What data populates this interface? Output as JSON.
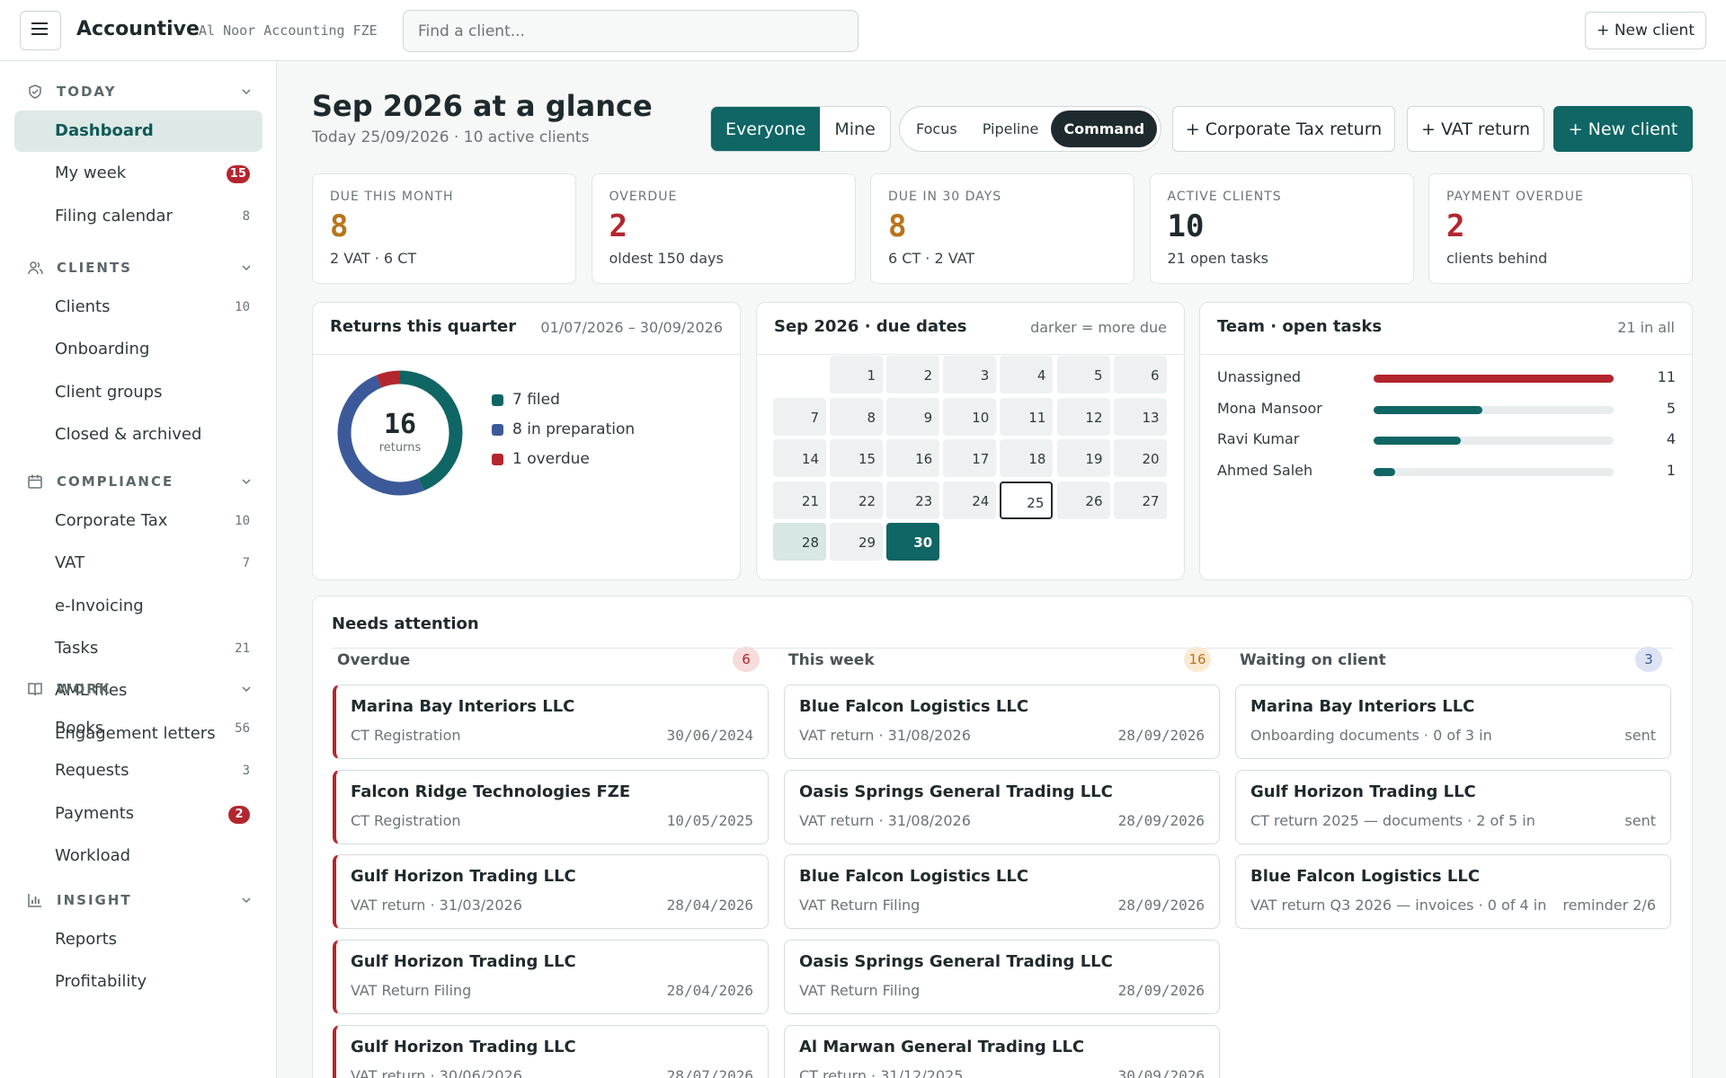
{
  "app": {
    "name": "Accountive",
    "org": "Al Noor Accounting FZE"
  },
  "search": {
    "placeholder": "Find a client..."
  },
  "top_new_label": "+ New client",
  "sidebar": {
    "sections": [
      {
        "label": "TODAY",
        "icon": "shield-check-icon"
      },
      {
        "label": "CLIENTS",
        "icon": "users-icon"
      },
      {
        "label": "COMPLIANCE",
        "icon": "calendar-icon"
      },
      {
        "label": "WORK",
        "icon": "book-icon"
      },
      {
        "label": "INSIGHT",
        "icon": "bar-chart-icon"
      }
    ],
    "items": [
      {
        "label": "Dashboard",
        "count": "",
        "badge": ""
      },
      {
        "label": "My week",
        "count": "",
        "badge": "15"
      },
      {
        "label": "Filing calendar",
        "count": "8",
        "badge": ""
      },
      {
        "label": "Clients",
        "count": "10",
        "badge": ""
      },
      {
        "label": "Onboarding",
        "count": "",
        "badge": ""
      },
      {
        "label": "Client groups",
        "count": "",
        "badge": ""
      },
      {
        "label": "Closed & archived",
        "count": "",
        "badge": ""
      },
      {
        "label": "Corporate Tax",
        "count": "10",
        "badge": ""
      },
      {
        "label": "VAT",
        "count": "7",
        "badge": ""
      },
      {
        "label": "e-Invoicing",
        "count": "",
        "badge": ""
      },
      {
        "label": "Tasks",
        "count": "21",
        "badge": ""
      },
      {
        "label": "AML files",
        "count": "",
        "badge": ""
      },
      {
        "label": "Engagement letters",
        "count": "",
        "badge": ""
      },
      {
        "label": "Books",
        "count": "56",
        "badge": ""
      },
      {
        "label": "Requests",
        "count": "3",
        "badge": ""
      },
      {
        "label": "Payments",
        "count": "",
        "badge": "2"
      },
      {
        "label": "Workload",
        "count": "",
        "badge": ""
      },
      {
        "label": "Reports",
        "count": "",
        "badge": ""
      },
      {
        "label": "Profitability",
        "count": "",
        "badge": ""
      }
    ]
  },
  "header": {
    "title": "Sep 2026 at a glance",
    "subtitle": "Today 25/09/2026 · 10 active clients"
  },
  "scope": {
    "options": [
      "Everyone",
      "Mine"
    ],
    "selected": "Everyone"
  },
  "view": {
    "options": [
      "Focus",
      "Pipeline",
      "Command"
    ],
    "selected": "Command"
  },
  "actions": {
    "ct_return": "+ Corporate Tax return",
    "vat_return": "+ VAT return",
    "new_client": "+ New client"
  },
  "kpis": [
    {
      "label": "DUE THIS MONTH",
      "value": "8",
      "sub": "2 VAT · 6 CT",
      "color": "#b8741a"
    },
    {
      "label": "OVERDUE",
      "value": "2",
      "sub": "oldest 150 days",
      "color": "#b3262d"
    },
    {
      "label": "DUE IN 30 DAYS",
      "value": "8",
      "sub": "6 CT · 2 VAT",
      "color": "#b8741a"
    },
    {
      "label": "ACTIVE CLIENTS",
      "value": "10",
      "sub": "21 open tasks",
      "color": "#1f2a2e"
    },
    {
      "label": "PAYMENT OVERDUE",
      "value": "2",
      "sub": "clients behind",
      "color": "#b3262d"
    }
  ],
  "returns": {
    "title": "Returns this quarter",
    "range": "01/07/2026 – 30/09/2026",
    "total": "16",
    "total_label": "returns",
    "segments": [
      {
        "label": "7 filed",
        "value": 7,
        "color": "#0f6664"
      },
      {
        "label": "8 in preparation",
        "value": 8,
        "color": "#3c5a9a"
      },
      {
        "label": "1 overdue",
        "value": 1,
        "color": "#b3262d"
      }
    ]
  },
  "calendar": {
    "title": "Sep 2026 · due dates",
    "note": "darker = more due",
    "first_weekday": 1,
    "days_in_month": 30,
    "today": 25,
    "highlight": 30,
    "light": 28
  },
  "team": {
    "title": "Team · open tasks",
    "total": "21 in all",
    "members": [
      {
        "name": "Unassigned",
        "count": 11,
        "color": "#b3262d"
      },
      {
        "name": "Mona Mansoor",
        "count": 5,
        "color": "#0f6664"
      },
      {
        "name": "Ravi Kumar",
        "count": 4,
        "color": "#0f6664"
      },
      {
        "name": "Ahmed Saleh",
        "count": 1,
        "color": "#0f6664"
      }
    ]
  },
  "attention": {
    "title": "Needs attention",
    "columns": [
      {
        "title": "Overdue",
        "count": "6",
        "count_bg": "#f6dcdc",
        "count_fg": "#b3262d",
        "items": [
          {
            "name": "Marina Bay Interiors LLC",
            "sub": "CT Registration",
            "right": "30/06/2024"
          },
          {
            "name": "Falcon Ridge Technologies FZE",
            "sub": "CT Registration",
            "right": "10/05/2025"
          },
          {
            "name": "Gulf Horizon Trading LLC",
            "sub": "VAT return · 31/03/2026",
            "right": "28/04/2026"
          },
          {
            "name": "Gulf Horizon Trading LLC",
            "sub": "VAT Return Filing",
            "right": "28/04/2026"
          },
          {
            "name": "Gulf Horizon Trading LLC",
            "sub": "VAT return · 30/06/2026",
            "right": "28/07/2026"
          }
        ]
      },
      {
        "title": "This week",
        "count": "16",
        "count_bg": "#fbead2",
        "count_fg": "#b8741a",
        "items": [
          {
            "name": "Blue Falcon Logistics LLC",
            "sub": "VAT return · 31/08/2026",
            "right": "28/09/2026"
          },
          {
            "name": "Oasis Springs General Trading LLC",
            "sub": "VAT return · 31/08/2026",
            "right": "28/09/2026"
          },
          {
            "name": "Blue Falcon Logistics LLC",
            "sub": "VAT Return Filing",
            "right": "28/09/2026"
          },
          {
            "name": "Oasis Springs General Trading LLC",
            "sub": "VAT Return Filing",
            "right": "28/09/2026"
          },
          {
            "name": "Al Marwan General Trading LLC",
            "sub": "CT return · 31/12/2025",
            "right": "30/09/2026"
          }
        ]
      },
      {
        "title": "Waiting on client",
        "count": "3",
        "count_bg": "#dde3f2",
        "count_fg": "#3c5a9a",
        "items": [
          {
            "name": "Marina Bay Interiors LLC",
            "sub": "Onboarding documents · 0 of 3 in",
            "right": "sent"
          },
          {
            "name": "Gulf Horizon Trading LLC",
            "sub": "CT return 2025 — documents · 2 of 5 in",
            "right": "sent"
          },
          {
            "name": "Blue Falcon Logistics LLC",
            "sub": "VAT return Q3 2026 — invoices · 0 of 4 in",
            "right": "reminder 2/6"
          }
        ]
      }
    ]
  }
}
